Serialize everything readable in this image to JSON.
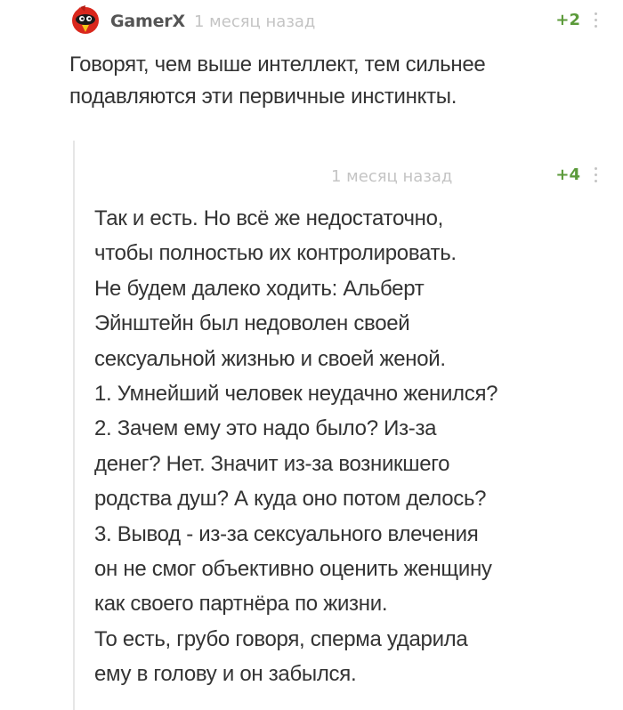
{
  "comment": {
    "author": "GamerX",
    "time": "1 месяц назад",
    "rating": "+2",
    "text": "Говорят, чем выше интеллект, тем сильнее\nподавляются эти первичные инстинкты.",
    "avatar_icon": "red-bird-avatar-icon"
  },
  "reply": {
    "time": "1 месяц назад",
    "rating": "+4",
    "lines": [
      "Так и есть. Но всё же недостаточно,",
      "чтобы полностью их контролировать.",
      "Не будем далеко ходить: Альберт",
      "Эйнштейн был недоволен своей",
      "сексуальной жизнью и своей женой.",
      "1. Умнейший человек неудачно женился?",
      "2. Зачем ему это надо было? Из-за",
      "денег? Нет. Значит из-за возникшего",
      "родства душ? А куда оно потом делось?",
      "3. Вывод - из-за сексуального влечения",
      "он не смог объективно оценить женщину",
      "как своего партнёра по жизни.",
      "То есть, грубо говоря, сперма ударила",
      "ему в голову и он забылся."
    ]
  },
  "colors": {
    "rating": "#5b9a3a",
    "muted": "#c4c4c4",
    "text": "#333333",
    "avatar_red": "#d9271c"
  }
}
